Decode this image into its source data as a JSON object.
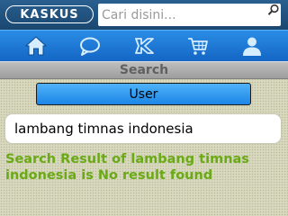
{
  "header": {
    "logo_text": "KASKUS",
    "search": {
      "value": "",
      "placeholder": "Cari disini..."
    },
    "search_icon": "search-icon"
  },
  "nav": {
    "items": [
      {
        "name": "home",
        "icon": "home-icon"
      },
      {
        "name": "chat",
        "icon": "chat-bubble-icon"
      },
      {
        "name": "kaskus",
        "icon": "kaskus-k-icon"
      },
      {
        "name": "cart",
        "icon": "shopping-cart-icon"
      },
      {
        "name": "profile",
        "icon": "user-icon"
      }
    ]
  },
  "page": {
    "title": "Search",
    "filter_button_label": "User",
    "query": "lambang timnas indonesia",
    "result_message": "Search Result of lambang timnas indonesia is No result found"
  },
  "colors": {
    "topbar": "#1f4f7d",
    "navbar": "#1a78d6",
    "button": "#2a98ee",
    "result_text": "#6aaa16",
    "page_background": "#d8d8be"
  }
}
